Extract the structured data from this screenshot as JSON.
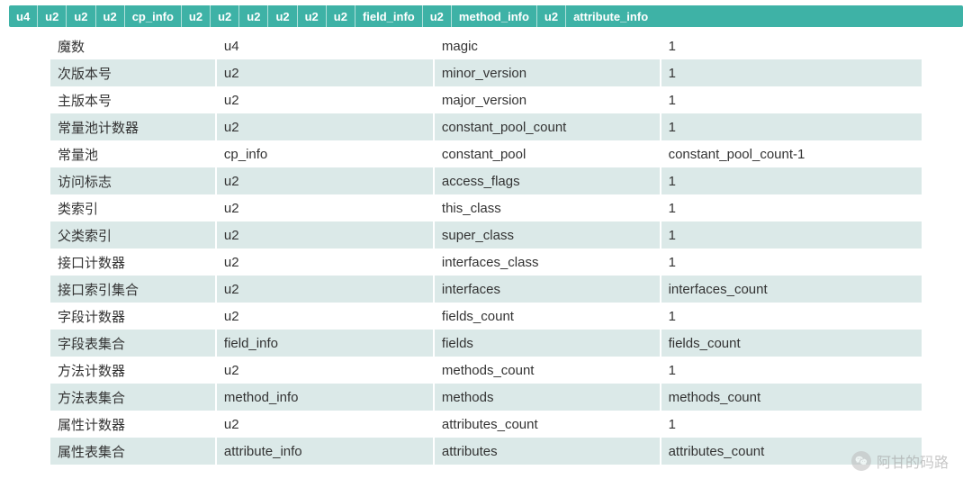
{
  "header": [
    "u4",
    "u2",
    "u2",
    "u2",
    "cp_info",
    "u2",
    "u2",
    "u2",
    "u2",
    "u2",
    "u2",
    "field_info",
    "u2",
    "method_info",
    "u2",
    "attribute_info"
  ],
  "rows": [
    {
      "desc": "魔数",
      "type": "u4",
      "name": "magic",
      "count": "1"
    },
    {
      "desc": "次版本号",
      "type": "u2",
      "name": "minor_version",
      "count": "1"
    },
    {
      "desc": "主版本号",
      "type": "u2",
      "name": "major_version",
      "count": "1"
    },
    {
      "desc": "常量池计数器",
      "type": "u2",
      "name": "constant_pool_count",
      "count": "1"
    },
    {
      "desc": "常量池",
      "type": "cp_info",
      "name": "constant_pool",
      "count": "constant_pool_count-1"
    },
    {
      "desc": "访问标志",
      "type": "u2",
      "name": "access_flags",
      "count": "1"
    },
    {
      "desc": "类索引",
      "type": "u2",
      "name": "this_class",
      "count": "1"
    },
    {
      "desc": "父类索引",
      "type": "u2",
      "name": "super_class",
      "count": "1"
    },
    {
      "desc": "接口计数器",
      "type": "u2",
      "name": "interfaces_class",
      "count": "1"
    },
    {
      "desc": "接口索引集合",
      "type": "u2",
      "name": "interfaces",
      "count": "interfaces_count"
    },
    {
      "desc": "字段计数器",
      "type": "u2",
      "name": "fields_count",
      "count": "1"
    },
    {
      "desc": "字段表集合",
      "type": "field_info",
      "name": "fields",
      "count": "fields_count"
    },
    {
      "desc": "方法计数器",
      "type": "u2",
      "name": "methods_count",
      "count": "1"
    },
    {
      "desc": "方法表集合",
      "type": "method_info",
      "name": "methods",
      "count": "methods_count"
    },
    {
      "desc": "属性计数器",
      "type": "u2",
      "name": "attributes_count",
      "count": "1"
    },
    {
      "desc": "属性表集合",
      "type": "attribute_info",
      "name": "attributes",
      "count": "attributes_count"
    }
  ],
  "watermark": {
    "text": "阿甘的码路"
  }
}
